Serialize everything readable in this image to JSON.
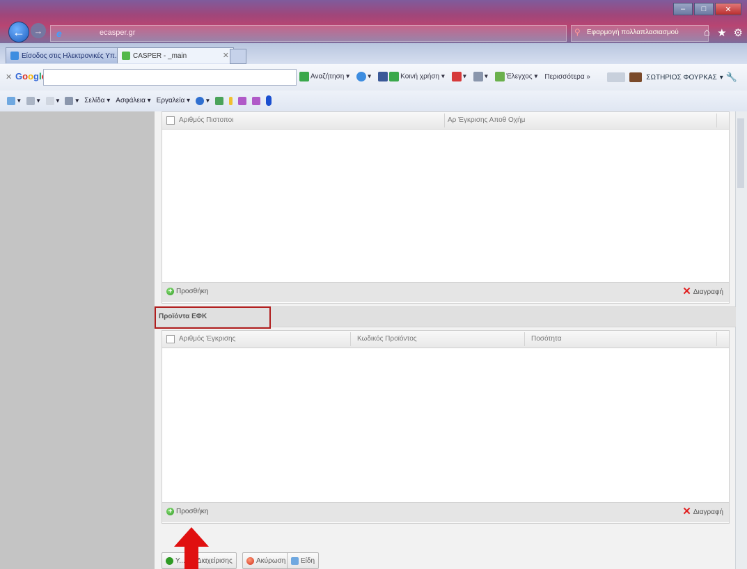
{
  "browser": {
    "address": "ecasper.gr",
    "search_text": "Εφαρμογή πολλαπλασιασμού",
    "tabs": [
      {
        "label": "Είσοδος στις Ηλεκτρονικές Υπ..."
      },
      {
        "label": "CASPER - _main"
      }
    ]
  },
  "google_toolbar": {
    "logo": "Google",
    "search_label": "Αναζήτηση",
    "share_label": "Κοινή χρήση",
    "check_label": "Έλεγχος",
    "more_label": "Περισσότερα »",
    "user_name": "ΣΩΤΗΡΙΟΣ ΦΟΥΡΚΑΣ"
  },
  "command_bar": {
    "page_label": "Σελίδα",
    "safety_label": "Ασφάλεια",
    "tools_label": "Εργαλεία"
  },
  "grid1": {
    "col1": "Αριθμός Πιστοποι",
    "col2": "Αρ Έγκρισης Αποθ Οχήμ",
    "add_label": "Προσθήκη",
    "delete_label": "Διαγραφή"
  },
  "section": {
    "title": "Προϊόντα ΕΦΚ"
  },
  "grid2": {
    "col1": "Αριθμός Έγκρισης",
    "col2": "Κωδικός Προϊόντος",
    "col3": "Ποσότητα",
    "add_label": "Προσθήκη",
    "delete_label": "Διαγραφή"
  },
  "footer_buttons": {
    "save_label": "Υ...",
    "save_partial": "Διαχείρισης",
    "cancel_label": "Ακύρωση",
    "items_label": "Είδη"
  },
  "colors": {
    "highlight": "#b01c1c",
    "add_icon": "#2f9a24",
    "delete_icon": "#e02020",
    "arrow": "#e01010"
  }
}
